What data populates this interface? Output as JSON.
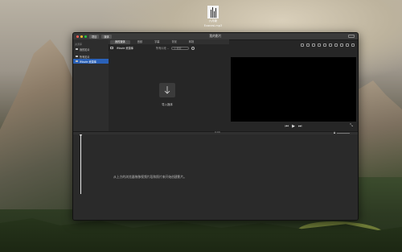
{
  "desktop": {
    "file_name_line1": "六月新",
    "file_name_line2": "Evanesi.mp3"
  },
  "window": {
    "title": "我的影片",
    "toolbar_buttons": [
      "项目",
      "媒体"
    ]
  },
  "sidebar": {
    "section_title": "资源库",
    "items": [
      {
        "label": "我的影片",
        "selected": false
      },
      {
        "label": "所有影片",
        "selected": false
      },
      {
        "label": "iMovie 资源库",
        "selected": true
      }
    ]
  },
  "tabs": [
    {
      "label": "我的媒体",
      "active": true
    },
    {
      "label": "音频",
      "active": false
    },
    {
      "label": "字幕",
      "active": false
    },
    {
      "label": "背景",
      "active": false
    },
    {
      "label": "转场",
      "active": false
    }
  ],
  "library_bar": {
    "title": "iMovie 资源库",
    "sort_label": "所有片段 ⌄",
    "search_placeholder": "搜索"
  },
  "import": {
    "label": "导入媒体"
  },
  "viewer": {
    "prev": "⏮",
    "play": "▶",
    "next": "⏭",
    "fullscreen": "⤡"
  },
  "timeline": {
    "timecode": "0:00",
    "hint": "从上方的浏览器拖移视频片段和照片来开始创建影片。"
  },
  "colors": {
    "selection": "#2a61b8",
    "traffic_close": "#ff5f56",
    "traffic_min": "#ffbd2e",
    "traffic_max": "#27c93f"
  }
}
